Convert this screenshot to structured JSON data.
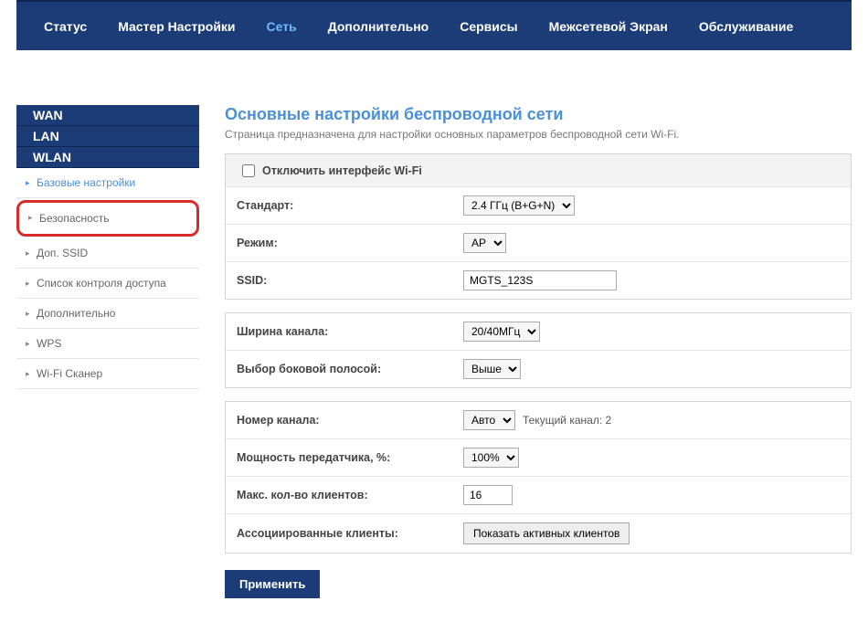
{
  "nav": {
    "items": [
      "Статус",
      "Мастер Настройки",
      "Сеть",
      "Дополнительно",
      "Сервисы",
      "Межсетевой Экран",
      "Обслуживание"
    ],
    "active_index": 2
  },
  "sidebar": {
    "sections": [
      "WAN",
      "LAN",
      "WLAN"
    ],
    "items": [
      "Базовые настройки",
      "Безопасность",
      "Доп. SSID",
      "Список контроля доступа",
      "Дополнительно",
      "WPS",
      "Wi-Fi Сканер"
    ]
  },
  "main": {
    "title": "Основные настройки беспроводной сети",
    "desc": "Страница предназначена для настройки основных параметров беспроводной сети Wi-Fi."
  },
  "form": {
    "disable_wifi_label": "Отключить интерфейс Wi-Fi",
    "standard_label": "Стандарт:",
    "standard_value": "2.4 ГГц (B+G+N)",
    "mode_label": "Режим:",
    "mode_value": "AP",
    "ssid_label": "SSID:",
    "ssid_value": "MGTS_123S",
    "ch_width_label": "Ширина канала:",
    "ch_width_value": "20/40МГц",
    "sideband_label": "Выбор боковой полосой:",
    "sideband_value": "Выше",
    "ch_num_label": "Номер канала:",
    "ch_num_value": "Авто",
    "ch_current_text": "Текущий канал: 2",
    "tx_power_label": "Мощность передатчика, %:",
    "tx_power_value": "100%",
    "max_clients_label": "Макс. кол-во клиентов:",
    "max_clients_value": "16",
    "assoc_clients_label": "Ассоциированные клиенты:",
    "assoc_clients_button": "Показать активных клиентов",
    "apply_button": "Применить"
  }
}
